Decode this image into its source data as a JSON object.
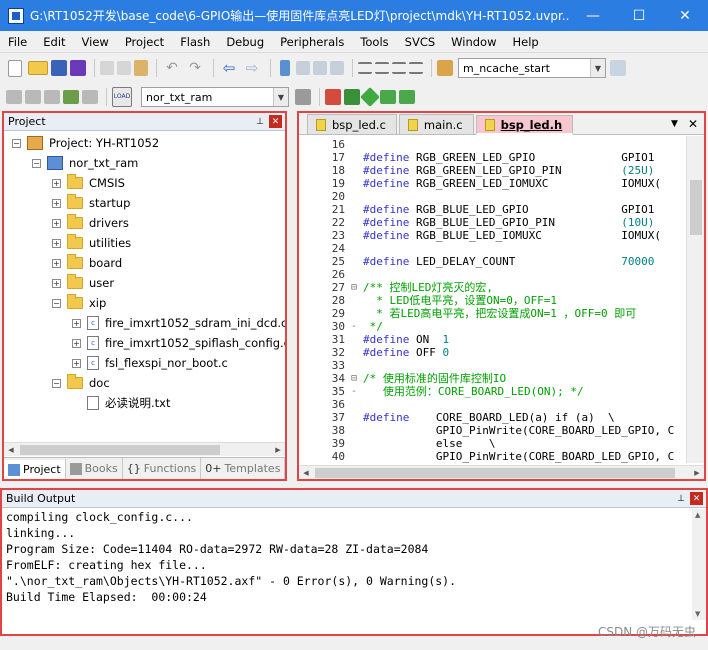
{
  "window": {
    "title": "G:\\RT1052开发\\base_code\\6-GPIO输出—使用固件库点亮LED灯\\project\\mdk\\YH-RT1052.uvpr...",
    "minimize": "—",
    "maximize": "☐",
    "close": "✕"
  },
  "menu": [
    "File",
    "Edit",
    "View",
    "Project",
    "Flash",
    "Debug",
    "Peripherals",
    "Tools",
    "SVCS",
    "Window",
    "Help"
  ],
  "toolbar1": {
    "find_combo": "m_ncache_start"
  },
  "toolbar2": {
    "target_combo": "nor_txt_ram"
  },
  "project_panel": {
    "title": "Project",
    "root": "Project: YH-RT1052",
    "target": "nor_txt_ram",
    "groups": [
      "CMSIS",
      "startup",
      "drivers",
      "utilities",
      "board",
      "user",
      "xip"
    ],
    "xip_files": [
      "fire_imxrt1052_sdram_ini_dcd.c",
      "fire_imxrt1052_spiflash_config.c",
      "fsl_flexspi_nor_boot.c"
    ],
    "doc_group": "doc",
    "doc_file": "必读说明.txt",
    "tabs": [
      "Project",
      "Books",
      "Functions",
      "Templates"
    ],
    "tab_icons": [
      "{}",
      "0+"
    ]
  },
  "editor": {
    "tabs": [
      "bsp_led.c",
      "main.c",
      "bsp_led.h"
    ],
    "lines": [
      {
        "n": "16",
        "f": "",
        "t": ""
      },
      {
        "n": "17",
        "f": "",
        "t": "#define RGB_GREEN_LED_GPIO             GPIO1"
      },
      {
        "n": "18",
        "f": "",
        "t": "#define RGB_GREEN_LED_GPIO_PIN         (25U)"
      },
      {
        "n": "19",
        "f": "",
        "t": "#define RGB_GREEN_LED_IOMUXC           IOMUX("
      },
      {
        "n": "20",
        "f": "",
        "t": ""
      },
      {
        "n": "21",
        "f": "",
        "t": "#define RGB_BLUE_LED_GPIO              GPIO1"
      },
      {
        "n": "22",
        "f": "",
        "t": "#define RGB_BLUE_LED_GPIO_PIN          (10U)"
      },
      {
        "n": "23",
        "f": "",
        "t": "#define RGB_BLUE_LED_IOMUXC            IOMUX("
      },
      {
        "n": "24",
        "f": "",
        "t": ""
      },
      {
        "n": "25",
        "f": "",
        "t": "#define LED_DELAY_COUNT                70000"
      },
      {
        "n": "26",
        "f": "",
        "t": ""
      },
      {
        "n": "27",
        "f": "⊟",
        "t": "/** 控制LED灯亮灭的宏,"
      },
      {
        "n": "28",
        "f": "",
        "t": "  * LED低电平亮，设置ON=0，OFF=1"
      },
      {
        "n": "29",
        "f": "",
        "t": "  * 若LED高电平亮，把宏设置成ON=1 ，OFF=0 即可"
      },
      {
        "n": "30",
        "f": "-",
        "t": " */"
      },
      {
        "n": "31",
        "f": "",
        "t": "#define ON  1"
      },
      {
        "n": "32",
        "f": "",
        "t": "#define OFF 0"
      },
      {
        "n": "33",
        "f": "",
        "t": ""
      },
      {
        "n": "34",
        "f": "⊟",
        "t": "/* 使用标准的固件库控制IO"
      },
      {
        "n": "35",
        "f": "-",
        "t": "   使用范例：CORE_BOARD_LED(ON); */"
      },
      {
        "n": "36",
        "f": "",
        "t": ""
      },
      {
        "n": "37",
        "f": "",
        "t": "#define    CORE_BOARD_LED(a) if (a)  \\"
      },
      {
        "n": "38",
        "f": "",
        "t": "           GPIO_PinWrite(CORE_BOARD_LED_GPIO, C"
      },
      {
        "n": "39",
        "f": "",
        "t": "           else    \\"
      },
      {
        "n": "40",
        "f": "",
        "t": "           GPIO_PinWrite(CORE_BOARD_LED_GPIO, C"
      }
    ]
  },
  "build_output": {
    "title": "Build Output",
    "lines": [
      "compiling clock_config.c...",
      "linking...",
      "Program Size: Code=11404 RO-data=2972 RW-data=28 ZI-data=2084",
      "FromELF: creating hex file...",
      "\".\\nor_txt_ram\\Objects\\YH-RT1052.axf\" - 0 Error(s), 0 Warning(s).",
      "Build Time Elapsed:  00:00:24"
    ]
  },
  "watermark": "CSDN @万码无虫"
}
